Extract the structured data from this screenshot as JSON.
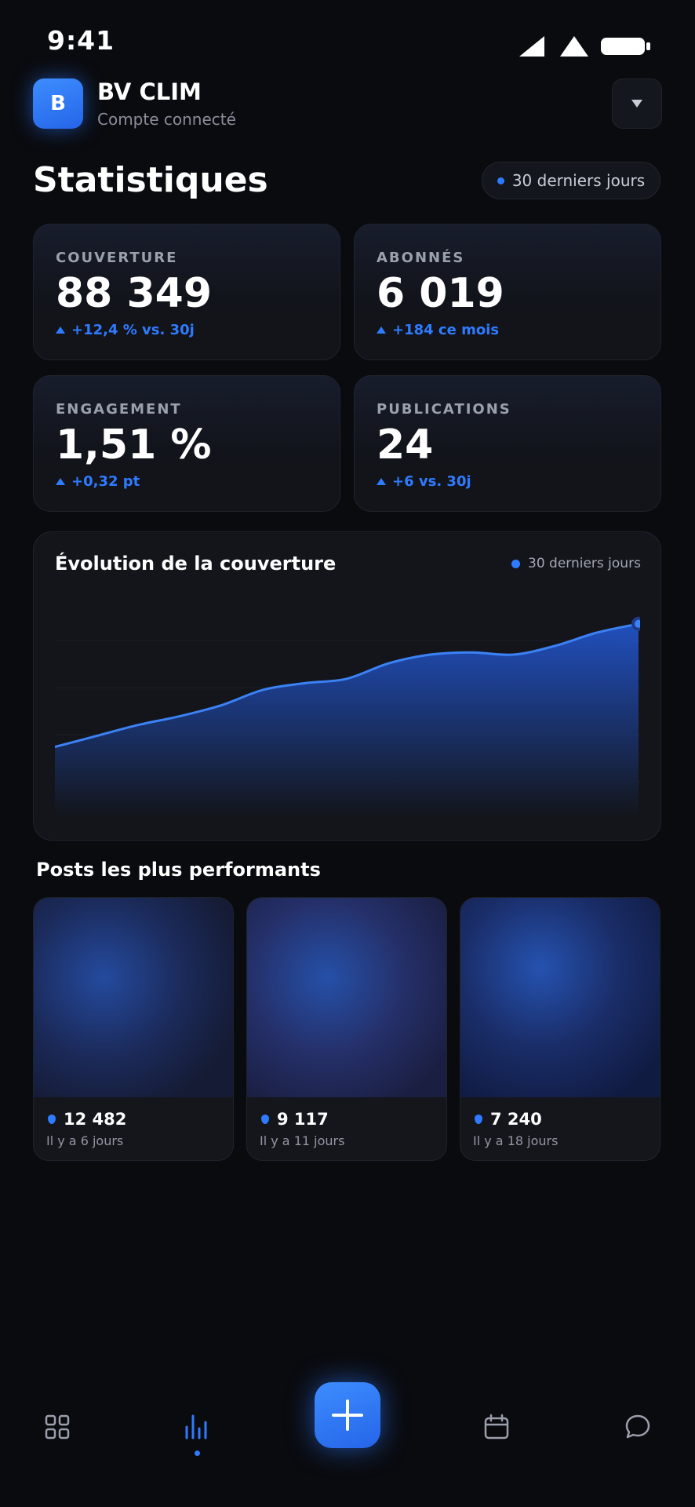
{
  "status_bar": {
    "time": "9:41"
  },
  "header": {
    "avatar_letter": "B",
    "account_name": "BV CLIM",
    "account_subtitle": "Compte connecté"
  },
  "page": {
    "title": "Statistiques",
    "period": "30 derniers jours"
  },
  "stats": [
    {
      "label": "COUVERTURE",
      "value": "88 349",
      "delta": "+12,4 % vs. 30j"
    },
    {
      "label": "ABONNÉS",
      "value": "6 019",
      "delta": "+184 ce mois"
    },
    {
      "label": "ENGAGEMENT",
      "value": "1,51 %",
      "delta": "+0,32 pt"
    },
    {
      "label": "PUBLICATIONS",
      "value": "24",
      "delta": "+6 vs. 30j"
    }
  ],
  "chart": {
    "title": "Évolution de la couverture",
    "legend": "30 derniers jours"
  },
  "chart_data": {
    "type": "area",
    "title": "Évolution de la couverture",
    "xlabel": "",
    "ylabel": "",
    "series": [
      {
        "values": [
          28,
          33,
          38,
          42,
          47,
          54,
          57,
          59,
          66,
          70,
          71,
          70,
          74,
          80,
          84
        ]
      }
    ],
    "grid": true
  },
  "posts_section": {
    "title": "Posts les plus performants",
    "items": [
      {
        "reach": "12 482",
        "age": "Il y a 6 jours"
      },
      {
        "reach": "9 117",
        "age": "Il y a 11 jours"
      },
      {
        "reach": "7 240",
        "age": "Il y a 18 jours"
      }
    ]
  },
  "nav": {
    "items": [
      "dashboard-icon",
      "stats-icon",
      "add-icon",
      "calendar-icon",
      "chat-icon"
    ],
    "active": "stats-icon"
  },
  "colors": {
    "accent": "#2f7bff",
    "background": "#0a0b0f",
    "card": "#13151b"
  }
}
